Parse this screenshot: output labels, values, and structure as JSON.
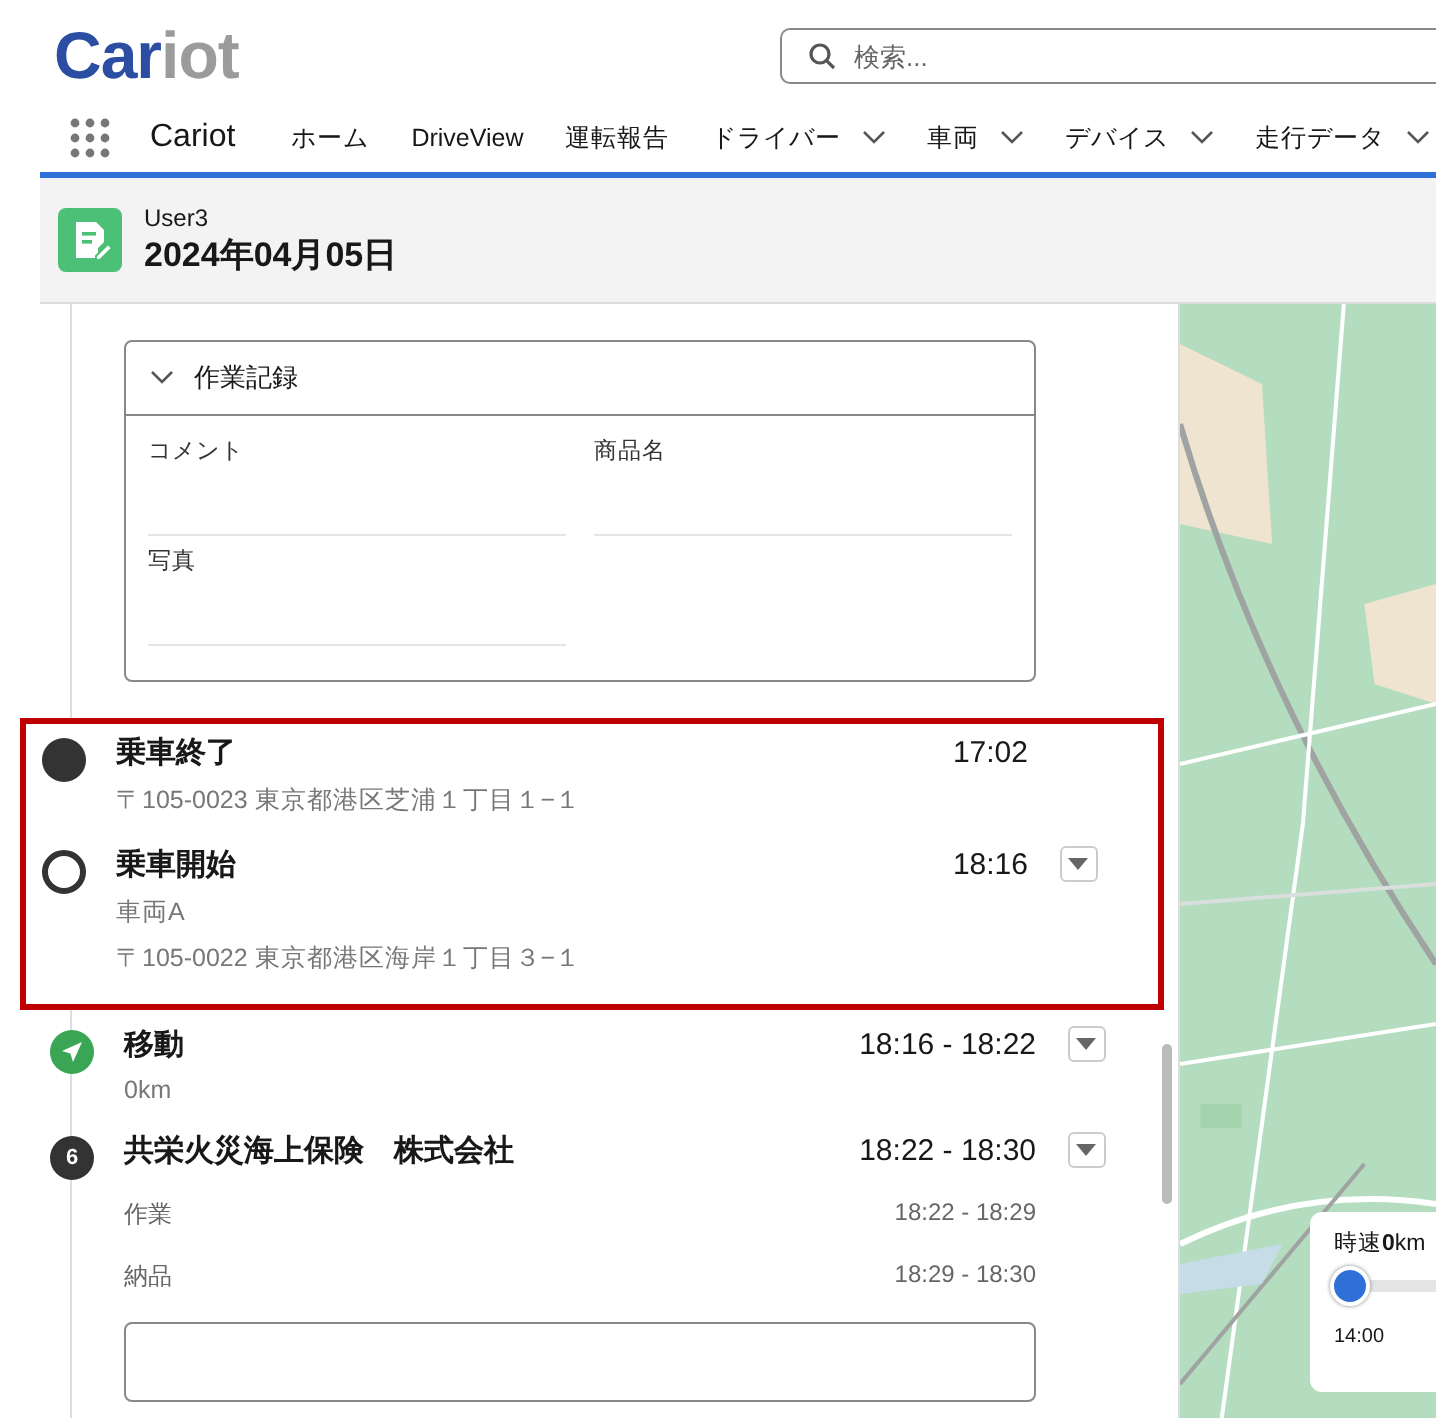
{
  "logo": {
    "parts": [
      {
        "text": "Car",
        "color": "#2b4ea2"
      },
      {
        "text": "iot",
        "color": "#9b9b9b"
      }
    ]
  },
  "search": {
    "placeholder": "検索..."
  },
  "nav": {
    "app_name": "Cariot",
    "items": [
      {
        "label": "ホーム",
        "dropdown": false
      },
      {
        "label": "DriveView",
        "dropdown": false
      },
      {
        "label": "運転報告",
        "dropdown": false
      },
      {
        "label": "ドライバー",
        "dropdown": true
      },
      {
        "label": "車両",
        "dropdown": true
      },
      {
        "label": "デバイス",
        "dropdown": true
      },
      {
        "label": "走行データ",
        "dropdown": true
      }
    ]
  },
  "record_header": {
    "user": "User3",
    "date": "2024年04月05日"
  },
  "work_record": {
    "title": "作業記録",
    "fields": [
      {
        "label": "コメント"
      },
      {
        "label": "商品名"
      },
      {
        "label": "写真"
      }
    ]
  },
  "highlighted": [
    {
      "kind": "end",
      "title": "乗車終了",
      "time": "17:02",
      "lines": [
        "〒105-0023 東京都港区芝浦１丁目１−１"
      ],
      "expandable": false
    },
    {
      "kind": "start",
      "title": "乗車開始",
      "time": "18:16",
      "lines": [
        "車両A",
        "〒105-0022 東京都港区海岸１丁目３−１"
      ],
      "expandable": true
    }
  ],
  "timeline": [
    {
      "kind": "move",
      "title": "移動",
      "time": "18:16 - 18:22",
      "lines": [
        "0km"
      ],
      "expandable": true
    },
    {
      "kind": "stop",
      "number": "6",
      "title": "共栄火災海上保険　株式会社",
      "time": "18:22 - 18:30",
      "expandable": true,
      "rows": [
        {
          "label": "作業",
          "time": "18:22 - 18:29"
        },
        {
          "label": "納品",
          "time": "18:29 - 18:30"
        }
      ]
    }
  ],
  "speed_panel": {
    "label": "時速**0**km",
    "level": 0,
    "tick": "14:00"
  }
}
